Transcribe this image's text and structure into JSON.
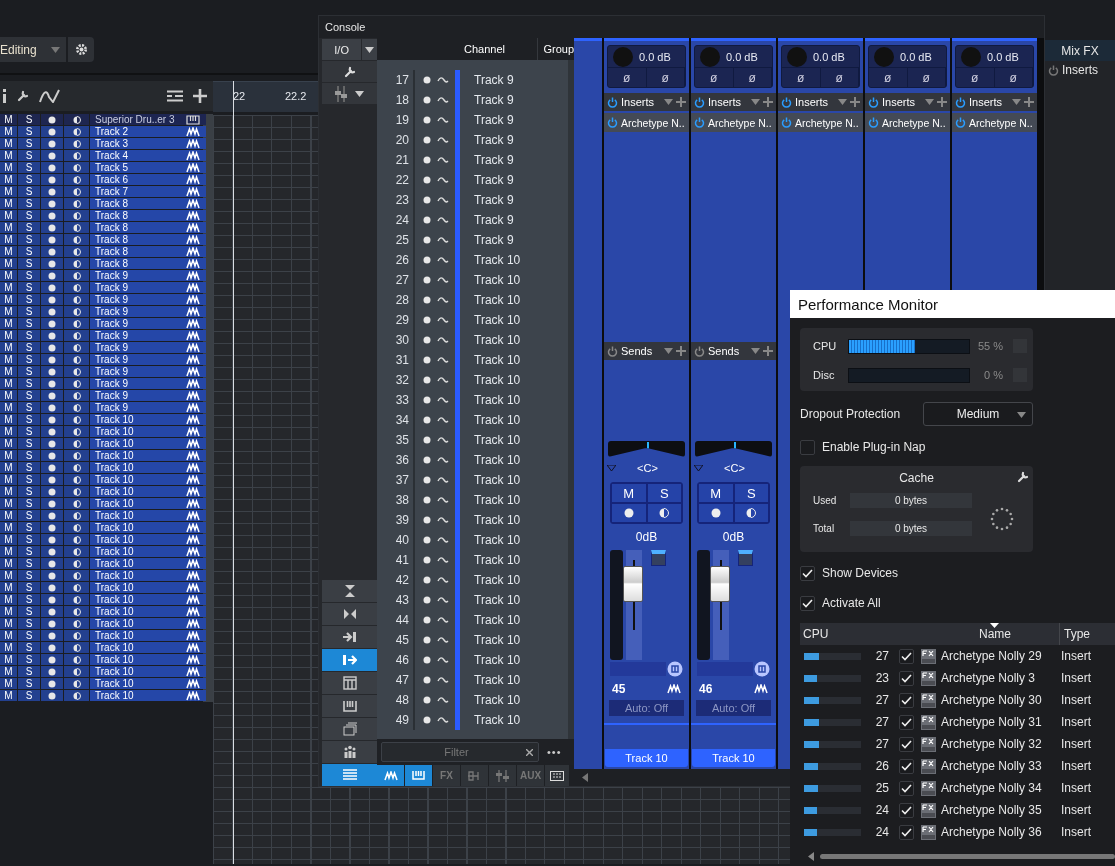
{
  "arrange": {
    "layout_menu": "Editing",
    "ruler": [
      "22",
      "22.2"
    ],
    "tracks": [
      {
        "mute": "M",
        "solo": "S",
        "name": "Superior Dru..er 3",
        "kind": "instrument",
        "selected": false
      },
      {
        "mute": "M",
        "solo": "S",
        "name": "Track 2",
        "kind": "audio",
        "selected": true
      },
      {
        "mute": "M",
        "solo": "S",
        "name": "Track 3",
        "kind": "audio",
        "selected": true
      },
      {
        "mute": "M",
        "solo": "S",
        "name": "Track 4",
        "kind": "audio",
        "selected": true
      },
      {
        "mute": "M",
        "solo": "S",
        "name": "Track 5",
        "kind": "audio",
        "selected": true
      },
      {
        "mute": "M",
        "solo": "S",
        "name": "Track 6",
        "kind": "audio",
        "selected": true
      },
      {
        "mute": "M",
        "solo": "S",
        "name": "Track 7",
        "kind": "audio",
        "selected": true
      },
      {
        "mute": "M",
        "solo": "S",
        "name": "Track 8",
        "kind": "audio",
        "selected": true
      },
      {
        "mute": "M",
        "solo": "S",
        "name": "Track 8",
        "kind": "audio",
        "selected": true
      },
      {
        "mute": "M",
        "solo": "S",
        "name": "Track 8",
        "kind": "audio",
        "selected": true
      },
      {
        "mute": "M",
        "solo": "S",
        "name": "Track 8",
        "kind": "audio",
        "selected": true
      },
      {
        "mute": "M",
        "solo": "S",
        "name": "Track 8",
        "kind": "audio",
        "selected": true
      },
      {
        "mute": "M",
        "solo": "S",
        "name": "Track 8",
        "kind": "audio",
        "selected": true
      },
      {
        "mute": "M",
        "solo": "S",
        "name": "Track 9",
        "kind": "audio",
        "selected": true
      },
      {
        "mute": "M",
        "solo": "S",
        "name": "Track 9",
        "kind": "audio",
        "selected": true
      },
      {
        "mute": "M",
        "solo": "S",
        "name": "Track 9",
        "kind": "audio",
        "selected": true
      },
      {
        "mute": "M",
        "solo": "S",
        "name": "Track 9",
        "kind": "audio",
        "selected": true
      },
      {
        "mute": "M",
        "solo": "S",
        "name": "Track 9",
        "kind": "audio",
        "selected": true
      },
      {
        "mute": "M",
        "solo": "S",
        "name": "Track 9",
        "kind": "audio",
        "selected": true
      },
      {
        "mute": "M",
        "solo": "S",
        "name": "Track 9",
        "kind": "audio",
        "selected": true
      },
      {
        "mute": "M",
        "solo": "S",
        "name": "Track 9",
        "kind": "audio",
        "selected": true
      },
      {
        "mute": "M",
        "solo": "S",
        "name": "Track 9",
        "kind": "audio",
        "selected": true
      },
      {
        "mute": "M",
        "solo": "S",
        "name": "Track 9",
        "kind": "audio",
        "selected": true
      },
      {
        "mute": "M",
        "solo": "S",
        "name": "Track 9",
        "kind": "audio",
        "selected": true
      },
      {
        "mute": "M",
        "solo": "S",
        "name": "Track 9",
        "kind": "audio",
        "selected": true
      },
      {
        "mute": "M",
        "solo": "S",
        "name": "Track 10",
        "kind": "audio",
        "selected": true
      },
      {
        "mute": "M",
        "solo": "S",
        "name": "Track 10",
        "kind": "audio",
        "selected": true
      },
      {
        "mute": "M",
        "solo": "S",
        "name": "Track 10",
        "kind": "audio",
        "selected": true
      },
      {
        "mute": "M",
        "solo": "S",
        "name": "Track 10",
        "kind": "audio",
        "selected": true
      },
      {
        "mute": "M",
        "solo": "S",
        "name": "Track 10",
        "kind": "audio",
        "selected": true
      },
      {
        "mute": "M",
        "solo": "S",
        "name": "Track 10",
        "kind": "audio",
        "selected": true
      },
      {
        "mute": "M",
        "solo": "S",
        "name": "Track 10",
        "kind": "audio",
        "selected": true
      },
      {
        "mute": "M",
        "solo": "S",
        "name": "Track 10",
        "kind": "audio",
        "selected": true
      },
      {
        "mute": "M",
        "solo": "S",
        "name": "Track 10",
        "kind": "audio",
        "selected": true
      },
      {
        "mute": "M",
        "solo": "S",
        "name": "Track 10",
        "kind": "audio",
        "selected": true
      },
      {
        "mute": "M",
        "solo": "S",
        "name": "Track 10",
        "kind": "audio",
        "selected": true
      },
      {
        "mute": "M",
        "solo": "S",
        "name": "Track 10",
        "kind": "audio",
        "selected": true
      },
      {
        "mute": "M",
        "solo": "S",
        "name": "Track 10",
        "kind": "audio",
        "selected": true
      },
      {
        "mute": "M",
        "solo": "S",
        "name": "Track 10",
        "kind": "audio",
        "selected": true
      },
      {
        "mute": "M",
        "solo": "S",
        "name": "Track 10",
        "kind": "audio",
        "selected": true
      },
      {
        "mute": "M",
        "solo": "S",
        "name": "Track 10",
        "kind": "audio",
        "selected": true
      },
      {
        "mute": "M",
        "solo": "S",
        "name": "Track 10",
        "kind": "audio",
        "selected": true
      },
      {
        "mute": "M",
        "solo": "S",
        "name": "Track 10",
        "kind": "audio",
        "selected": true
      },
      {
        "mute": "M",
        "solo": "S",
        "name": "Track 10",
        "kind": "audio",
        "selected": true
      },
      {
        "mute": "M",
        "solo": "S",
        "name": "Track 10",
        "kind": "audio",
        "selected": true
      },
      {
        "mute": "M",
        "solo": "S",
        "name": "Track 10",
        "kind": "audio",
        "selected": true
      },
      {
        "mute": "M",
        "solo": "S",
        "name": "Track 10",
        "kind": "audio",
        "selected": true
      },
      {
        "mute": "M",
        "solo": "S",
        "name": "Track 10",
        "kind": "audio",
        "selected": true
      },
      {
        "mute": "M",
        "solo": "S",
        "name": "Track 10",
        "kind": "audio",
        "selected": true
      }
    ]
  },
  "console": {
    "title": "Console",
    "io": "I/O",
    "columns": [
      "Channel",
      "Group"
    ],
    "channels": [
      {
        "number": "17",
        "name": "Track 9"
      },
      {
        "number": "18",
        "name": "Track 9"
      },
      {
        "number": "19",
        "name": "Track 9"
      },
      {
        "number": "20",
        "name": "Track 9"
      },
      {
        "number": "21",
        "name": "Track 9"
      },
      {
        "number": "22",
        "name": "Track 9"
      },
      {
        "number": "23",
        "name": "Track 9"
      },
      {
        "number": "24",
        "name": "Track 9"
      },
      {
        "number": "25",
        "name": "Track 9"
      },
      {
        "number": "26",
        "name": "Track 10"
      },
      {
        "number": "27",
        "name": "Track 10"
      },
      {
        "number": "28",
        "name": "Track 10"
      },
      {
        "number": "29",
        "name": "Track 10"
      },
      {
        "number": "30",
        "name": "Track 10"
      },
      {
        "number": "31",
        "name": "Track 10"
      },
      {
        "number": "32",
        "name": "Track 10"
      },
      {
        "number": "33",
        "name": "Track 10"
      },
      {
        "number": "34",
        "name": "Track 10"
      },
      {
        "number": "35",
        "name": "Track 10"
      },
      {
        "number": "36",
        "name": "Track 10"
      },
      {
        "number": "37",
        "name": "Track 10"
      },
      {
        "number": "38",
        "name": "Track 10"
      },
      {
        "number": "39",
        "name": "Track 10"
      },
      {
        "number": "40",
        "name": "Track 10"
      },
      {
        "number": "41",
        "name": "Track 10"
      },
      {
        "number": "42",
        "name": "Track 10"
      },
      {
        "number": "43",
        "name": "Track 10"
      },
      {
        "number": "44",
        "name": "Track 10"
      },
      {
        "number": "45",
        "name": "Track 10"
      },
      {
        "number": "46",
        "name": "Track 10"
      },
      {
        "number": "47",
        "name": "Track 10"
      },
      {
        "number": "48",
        "name": "Track 10"
      },
      {
        "number": "49",
        "name": "Track 10"
      }
    ],
    "view_buttons": [
      {
        "kind": "expand",
        "selected": false
      },
      {
        "kind": "narrow",
        "selected": false
      },
      {
        "kind": "input",
        "selected": false
      },
      {
        "kind": "output",
        "selected": true
      },
      {
        "kind": "banks",
        "selected": false
      },
      {
        "kind": "keyboard",
        "selected": false
      },
      {
        "kind": "stack",
        "selected": false
      },
      {
        "kind": "people",
        "selected": false
      },
      {
        "kind": "list",
        "selected": true
      }
    ],
    "filter": {
      "placeholder": "Filter"
    },
    "more": "•••",
    "list_tabs": [
      {
        "kind": "audio",
        "selected": true
      },
      {
        "kind": "instrument",
        "selected": true
      },
      {
        "kind": "text",
        "label": "FX",
        "selected": false
      },
      {
        "kind": "bus",
        "selected": false
      },
      {
        "kind": "vca",
        "selected": false
      },
      {
        "kind": "text",
        "label": "AUX",
        "selected": false
      },
      {
        "kind": "grid",
        "selected": false
      }
    ],
    "strips": [
      {
        "gain": "0.0 dB",
        "phase": [
          "ø",
          "ø"
        ],
        "inserts": "Inserts",
        "insert": "Archetype N..",
        "sends": "Sends",
        "pan": "<C>",
        "mute": "M",
        "solo": "S",
        "volume": "0dB",
        "level": 0.78,
        "number": "45",
        "automation": "Auto: Off",
        "name": "Track 10"
      },
      {
        "gain": "0.0 dB",
        "phase": [
          "ø",
          "ø"
        ],
        "inserts": "Inserts",
        "insert": "Archetype N..",
        "sends": "Sends",
        "pan": "<C>",
        "mute": "M",
        "solo": "S",
        "volume": "0dB",
        "level": 0.78,
        "number": "46",
        "automation": "Auto: Off",
        "name": "Track 10"
      },
      {
        "gain": "0.0 dB",
        "phase": [
          "ø",
          "ø"
        ],
        "inserts": "Inserts",
        "insert": "Archetype N.."
      },
      {
        "gain": "0.0 dB",
        "phase": [
          "ø",
          "ø"
        ],
        "inserts": "Inserts",
        "insert": "Archetype N.."
      },
      {
        "gain": "0.0 dB",
        "phase": [
          "ø",
          "ø"
        ],
        "inserts": "Inserts",
        "insert": "Archetype N.."
      }
    ]
  },
  "mix_fx": {
    "title": "Mix FX",
    "inserts": "Inserts"
  },
  "performance_monitor": {
    "title": "Performance Monitor",
    "meters": [
      {
        "label": "CPU",
        "level": 0.55,
        "reading": "55 %"
      },
      {
        "label": "Disc",
        "level": 0,
        "reading": "0 %"
      }
    ],
    "dropout_protection": {
      "label": "Dropout Protection",
      "value": "Medium"
    },
    "plugin_nap": {
      "label": "Enable Plug-in Nap",
      "checked": false
    },
    "cache": {
      "title": "Cache",
      "rows": [
        {
          "label": "Used",
          "value": "0 bytes"
        },
        {
          "label": "Total",
          "value": "0 bytes"
        }
      ]
    },
    "options": [
      {
        "label": "Show Devices",
        "checked": true
      },
      {
        "label": "Activate All",
        "checked": true
      }
    ],
    "table": {
      "columns": [
        "CPU",
        "Name",
        "Type"
      ],
      "rows": [
        {
          "level": 0.27,
          "cpu": "27",
          "active": true,
          "name": "Archetype Nolly 29",
          "type": "Insert"
        },
        {
          "level": 0.22,
          "cpu": "23",
          "active": true,
          "name": "Archetype Nolly 3",
          "type": "Insert"
        },
        {
          "level": 0.27,
          "cpu": "27",
          "active": true,
          "name": "Archetype Nolly 30",
          "type": "Insert"
        },
        {
          "level": 0.27,
          "cpu": "27",
          "active": true,
          "name": "Archetype Nolly 31",
          "type": "Insert"
        },
        {
          "level": 0.27,
          "cpu": "27",
          "active": true,
          "name": "Archetype Nolly 32",
          "type": "Insert"
        },
        {
          "level": 0.25,
          "cpu": "26",
          "active": true,
          "name": "Archetype Nolly 33",
          "type": "Insert"
        },
        {
          "level": 0.25,
          "cpu": "25",
          "active": true,
          "name": "Archetype Nolly 34",
          "type": "Insert"
        },
        {
          "level": 0.23,
          "cpu": "24",
          "active": true,
          "name": "Archetype Nolly 35",
          "type": "Insert"
        },
        {
          "level": 0.23,
          "cpu": "24",
          "active": true,
          "name": "Archetype Nolly 36",
          "type": "Insert"
        }
      ]
    }
  }
}
